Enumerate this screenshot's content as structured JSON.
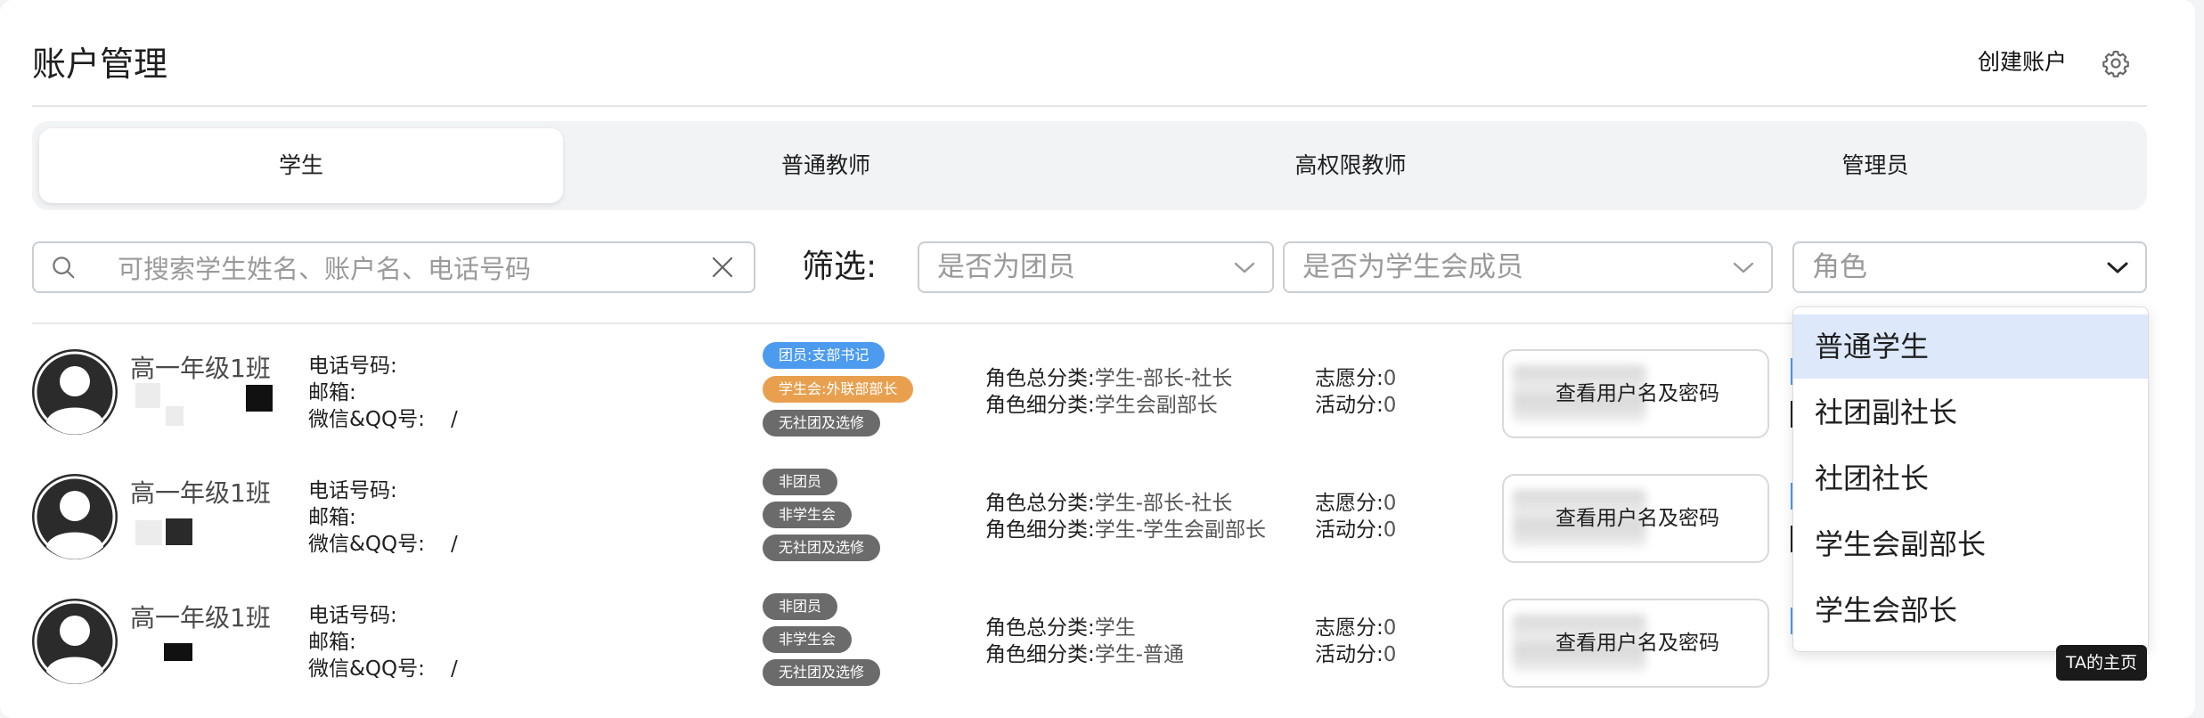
{
  "page": {
    "title": "账户管理"
  },
  "header": {
    "create_label": "创建账户",
    "settings_icon": "gear-icon"
  },
  "tabs": [
    {
      "label": "学生",
      "active": true
    },
    {
      "label": "普通教师",
      "active": false
    },
    {
      "label": "高权限教师",
      "active": false
    },
    {
      "label": "管理员",
      "active": false
    }
  ],
  "search": {
    "placeholder": "可搜索学生姓名、账户名、电话号码",
    "value": ""
  },
  "filter": {
    "label": "筛选:",
    "selects": [
      {
        "placeholder": "是否为团员"
      },
      {
        "placeholder": "是否为学生会成员"
      },
      {
        "placeholder": "角色",
        "open": true
      }
    ],
    "role_options": [
      {
        "label": "普通学生",
        "highlighted": true
      },
      {
        "label": "社团副社长",
        "highlighted": false
      },
      {
        "label": "社团社长",
        "highlighted": false
      },
      {
        "label": "学生会副部长",
        "highlighted": false
      },
      {
        "label": "学生会部长",
        "highlighted": false
      }
    ]
  },
  "labels": {
    "phone": "电话号码:",
    "email": "邮箱:",
    "wechat": "微信&QQ号:",
    "role_main": "角色总分类:",
    "role_sub": "角色细分类:",
    "volunteer": "志愿分:",
    "activity": "活动分:",
    "view_button": "查看用户名及密码",
    "homepage_tooltip": "TA的主页"
  },
  "students": [
    {
      "class_name": "高一年级1班",
      "wechat": "/",
      "tags": [
        {
          "text": "团员:支部书记",
          "color": "#4c9bef"
        },
        {
          "text": "学生会:外联部部长",
          "color": "#e8a04f"
        },
        {
          "text": "无社团及选修",
          "color": "#6b6b6b"
        }
      ],
      "role_main": "学生-部长-社长",
      "role_sub": "学生会副部长",
      "volunteer": "0",
      "activity": "0"
    },
    {
      "class_name": "高一年级1班",
      "wechat": "/",
      "tags": [
        {
          "text": "非团员",
          "color": "#6b6b6b"
        },
        {
          "text": "非学生会",
          "color": "#6b6b6b"
        },
        {
          "text": "无社团及选修",
          "color": "#6b6b6b"
        }
      ],
      "role_main": "学生-部长-社长",
      "role_sub": "学生-学生会副部长",
      "volunteer": "0",
      "activity": "0"
    },
    {
      "class_name": "高一年级1班",
      "wechat": "/",
      "tags": [
        {
          "text": "非团员",
          "color": "#6b6b6b"
        },
        {
          "text": "非学生会",
          "color": "#6b6b6b"
        },
        {
          "text": "无社团及选修",
          "color": "#6b6b6b"
        }
      ],
      "role_main": "学生",
      "role_sub": "学生-普通",
      "volunteer": "0",
      "activity": "0"
    }
  ]
}
